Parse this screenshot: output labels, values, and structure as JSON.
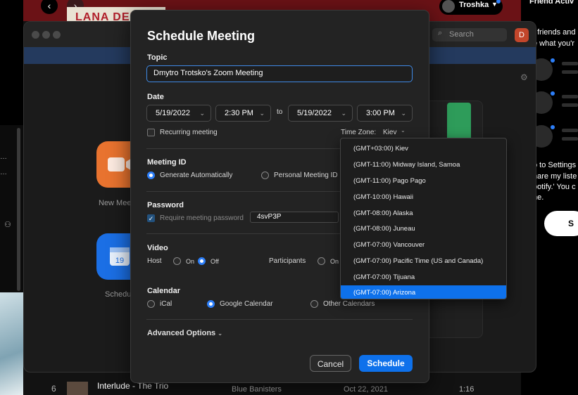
{
  "spotify": {
    "banner_text": "LANA DEL RE",
    "user_name": "Troshka",
    "friend_title": "Friend Activ",
    "friend_text_1": "t friends and",
    "friend_text_2": "e what you'r",
    "friend_text_3": "o to Settings",
    "friend_text_4": "hare my liste",
    "friend_text_5": "potify.' You c",
    "friend_text_6": "ne.",
    "settings_button": "S",
    "track": {
      "num": "6",
      "title": "Interlude - The Trio",
      "album": "Blue Banisters",
      "date": "Oct 22, 2021",
      "duration": "1:16"
    }
  },
  "zoom": {
    "search_placeholder": "Search",
    "avatar_letter": "D",
    "new_meeting_label": "New Meet",
    "schedule_label": "Schedu",
    "calendar_day": "19"
  },
  "dialog": {
    "title": "Schedule Meeting",
    "topic_label": "Topic",
    "topic_value": "Dmytro Trotsko's Zoom Meeting",
    "date_label": "Date",
    "start_date": "5/19/2022",
    "start_time": "2:30 PM",
    "to_label": "to",
    "end_date": "5/19/2022",
    "end_time": "3:00 PM",
    "recurring_label": "Recurring meeting",
    "timezone_label": "Time Zone:",
    "timezone_value": "Kiev",
    "meeting_id_label": "Meeting ID",
    "generate_auto": "Generate Automatically",
    "personal_id": "Personal Meeting ID",
    "password_label": "Password",
    "require_password": "Require meeting password",
    "password_value": "4svP3P",
    "video_label": "Video",
    "host_label": "Host",
    "on_label": "On",
    "off_label": "Off",
    "participants_label": "Participants",
    "calendar_label": "Calendar",
    "ical": "iCal",
    "google_calendar": "Google Calendar",
    "other_calendars": "Other Calendars",
    "advanced_options": "Advanced Options",
    "cancel": "Cancel",
    "schedule": "Schedule"
  },
  "timezones": [
    "(GMT+03:00)  Kiev",
    "(GMT-11:00)  Midway Island, Samoa",
    "(GMT-11:00)  Pago Pago",
    "(GMT-10:00)  Hawaii",
    "(GMT-08:00)  Alaska",
    "(GMT-08:00)  Juneau",
    "(GMT-07:00)  Vancouver",
    "(GMT-07:00)  Pacific Time (US and Canada)",
    "(GMT-07:00)  Tijuana",
    "(GMT-07:00)  Arizona"
  ],
  "colors": {
    "accent": "#0e71eb",
    "spotify_header": "#6b1216"
  }
}
